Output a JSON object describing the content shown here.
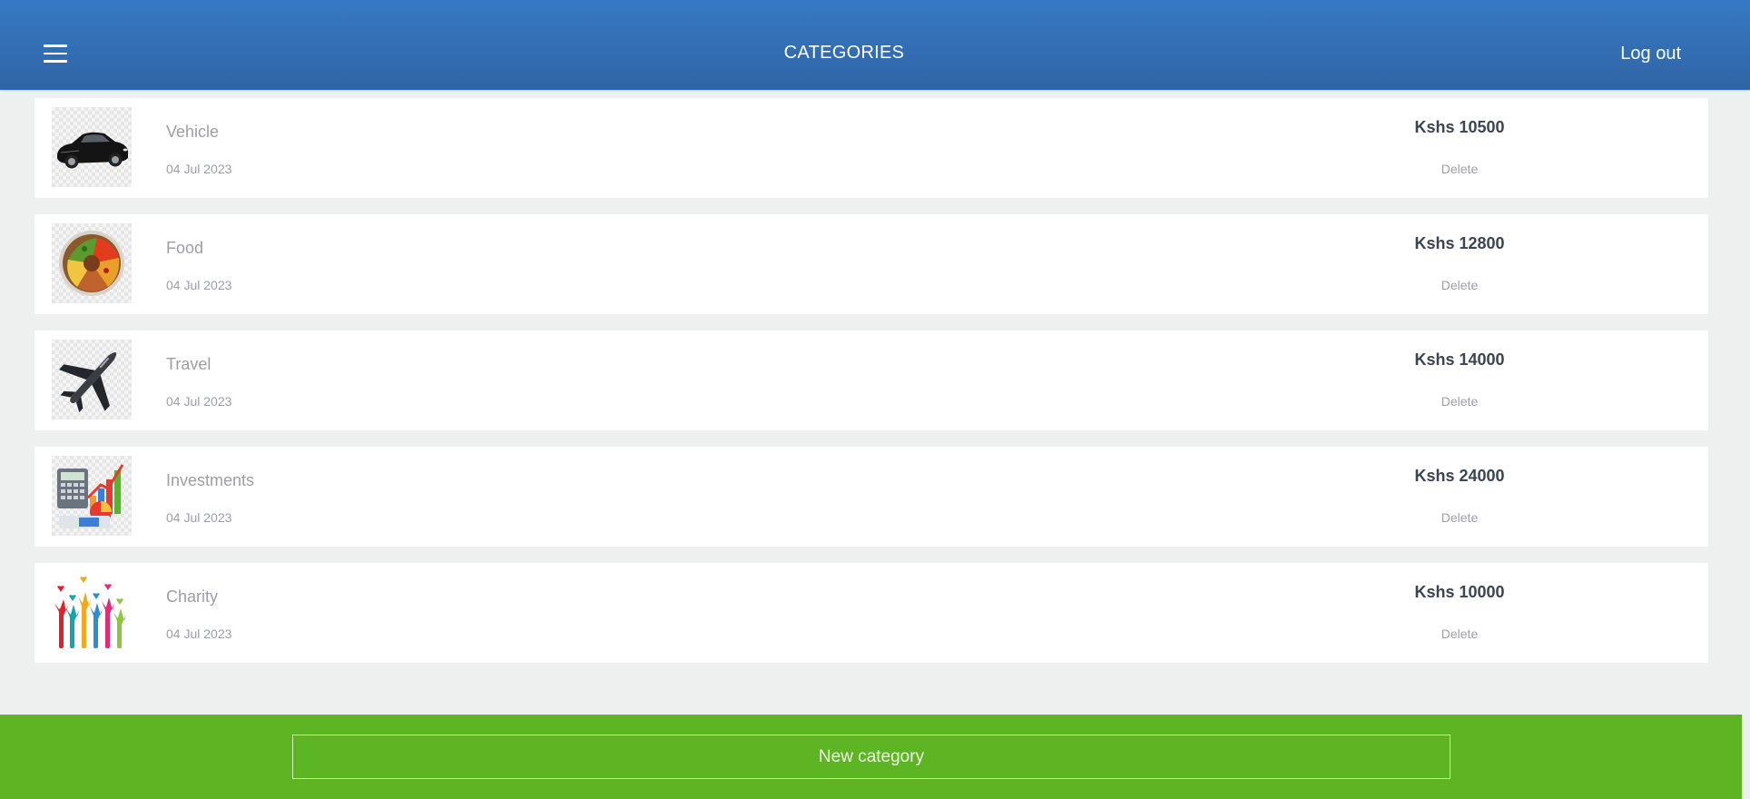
{
  "header": {
    "title": "CATEGORIES",
    "logout_label": "Log out"
  },
  "categories": [
    {
      "name": "Vehicle",
      "date": "04 Jul 2023",
      "amount": "Kshs 10500",
      "delete_label": "Delete",
      "icon": "car-icon"
    },
    {
      "name": "Food",
      "date": "04 Jul 2023",
      "amount": "Kshs 12800",
      "delete_label": "Delete",
      "icon": "food-bowl-icon"
    },
    {
      "name": "Travel",
      "date": "04 Jul 2023",
      "amount": "Kshs 14000",
      "delete_label": "Delete",
      "icon": "airplane-icon"
    },
    {
      "name": "Investments",
      "date": "04 Jul 2023",
      "amount": "Kshs 24000",
      "delete_label": "Delete",
      "icon": "investment-chart-icon"
    },
    {
      "name": "Charity",
      "date": "04 Jul 2023",
      "amount": "Kshs 10000",
      "delete_label": "Delete",
      "icon": "charity-hands-icon"
    }
  ],
  "footer": {
    "new_category_label": "New category"
  },
  "colors": {
    "header": "#3370b8",
    "footer": "#5db523",
    "background": "#eef0ef"
  }
}
